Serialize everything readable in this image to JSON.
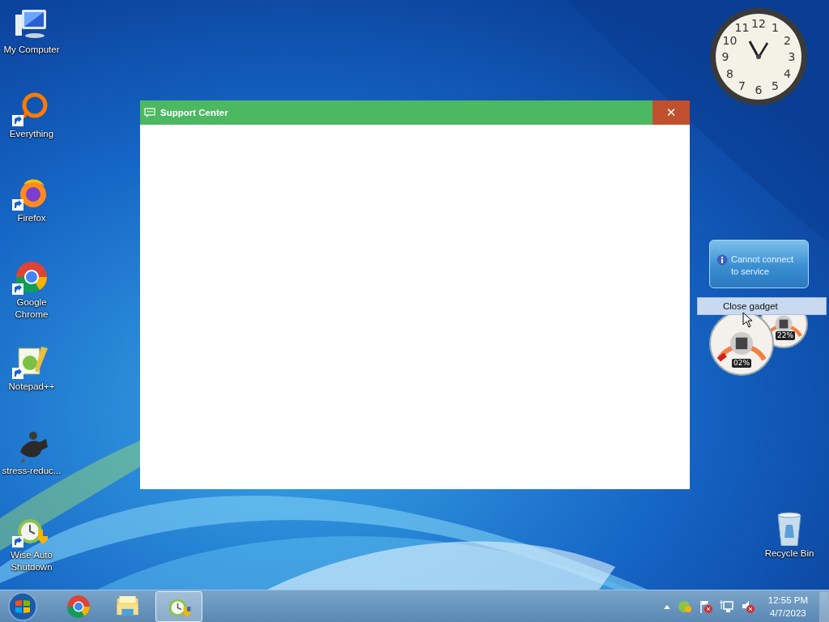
{
  "desktop": {
    "icons": [
      {
        "label": "My Computer",
        "kind": "computer",
        "shortcut": false
      },
      {
        "label": "Everything",
        "kind": "everything",
        "shortcut": true
      },
      {
        "label": "Firefox",
        "kind": "firefox",
        "shortcut": true
      },
      {
        "label": "Google Chrome",
        "kind": "chrome",
        "shortcut": true
      },
      {
        "label": "Notepad++",
        "kind": "notepad",
        "shortcut": true
      },
      {
        "label": "stress-reduc...",
        "kind": "figure",
        "shortcut": false
      },
      {
        "label": "Wise Auto Shutdown",
        "kind": "wise",
        "shortcut": true
      }
    ],
    "recycle_bin": {
      "label": "Recycle Bin"
    }
  },
  "window": {
    "title": "Support Center",
    "close": "✕"
  },
  "clock_gadget": {
    "numbers": [
      "12",
      "11",
      "1",
      "10",
      "2",
      "9",
      "3",
      "8",
      "4",
      "7",
      "5",
      "6"
    ]
  },
  "weather_gadget": {
    "message": "Cannot connect to service"
  },
  "context_menu": {
    "items": [
      "Close gadget"
    ]
  },
  "cpu_gadget": {
    "readings": [
      "02%",
      "22%"
    ]
  },
  "taskbar": {
    "apps": [
      {
        "kind": "chrome",
        "selected": false
      },
      {
        "kind": "explorer",
        "selected": false
      },
      {
        "kind": "wise",
        "selected": true
      }
    ],
    "tray": {
      "time": "12:55 PM",
      "date": "4/7/2023"
    }
  }
}
